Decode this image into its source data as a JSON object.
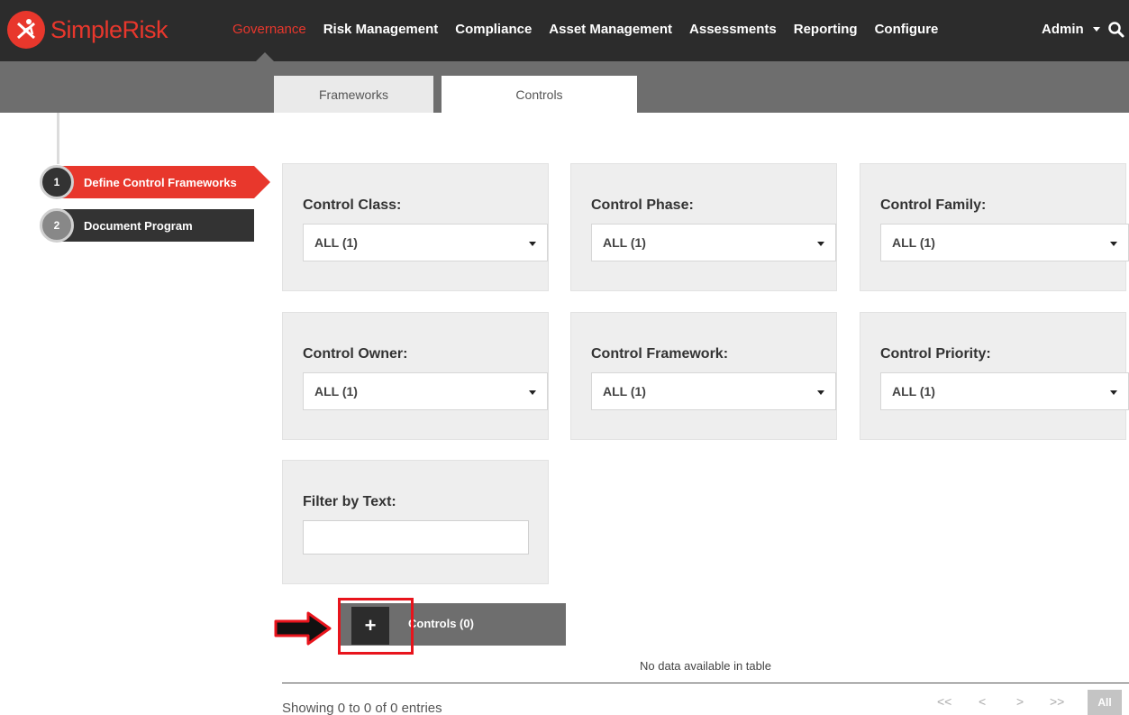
{
  "header": {
    "logo_text": "SimpleRisk",
    "nav": [
      "Governance",
      "Risk Management",
      "Compliance",
      "Asset Management",
      "Assessments",
      "Reporting",
      "Configure"
    ],
    "active_nav": "Governance",
    "user_menu": "Admin"
  },
  "tabs": [
    {
      "label": "Frameworks",
      "active": false
    },
    {
      "label": "Controls",
      "active": true
    }
  ],
  "steps": [
    {
      "number": "1",
      "label": "Define Control Frameworks",
      "active": true
    },
    {
      "number": "2",
      "label": "Document Program",
      "active": false
    }
  ],
  "filters": {
    "control_class": {
      "label": "Control Class:",
      "value": "ALL (1)"
    },
    "control_phase": {
      "label": "Control Phase:",
      "value": "ALL (1)"
    },
    "control_family": {
      "label": "Control Family:",
      "value": "ALL (1)"
    },
    "control_owner": {
      "label": "Control Owner:",
      "value": "ALL (1)"
    },
    "control_framework": {
      "label": "Control Framework:",
      "value": "ALL (1)"
    },
    "control_priority": {
      "label": "Control Priority:",
      "value": "ALL (1)"
    },
    "filter_text": {
      "label": "Filter by Text:",
      "value": ""
    }
  },
  "controls": {
    "title": "Controls (0)",
    "add_label": "+",
    "empty_message": "No data available in table",
    "showing": "Showing 0 to 0 of 0 entries"
  },
  "pagination": {
    "first": "<<",
    "prev": "<",
    "next": ">",
    "last": ">>",
    "all": "All"
  },
  "colors": {
    "accent": "#e8372c",
    "topbar": "#2c2c2c",
    "subbar": "#6e6e6e",
    "highlight": "#e8141c"
  }
}
